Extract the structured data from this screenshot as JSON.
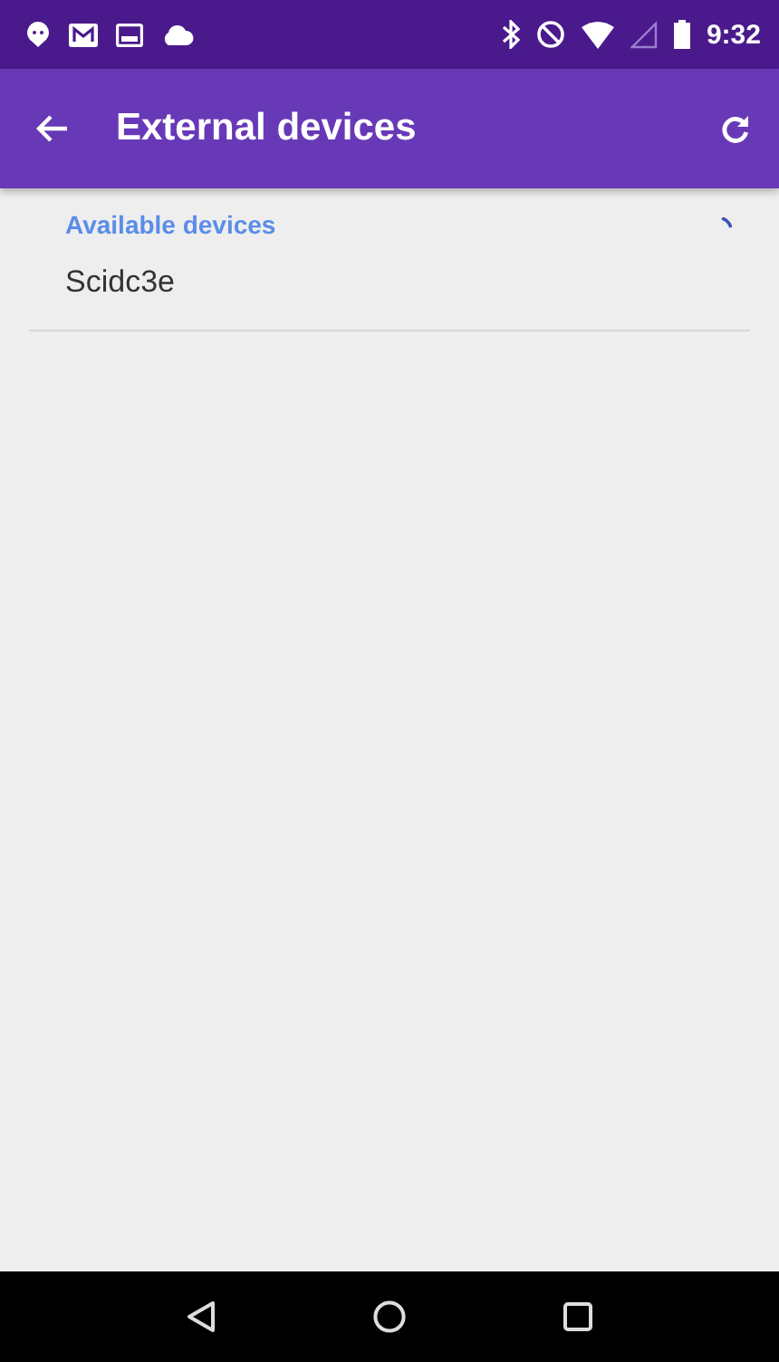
{
  "status_bar": {
    "time": "9:32"
  },
  "app_bar": {
    "title": "External devices"
  },
  "section": {
    "header": "Available devices"
  },
  "devices": [
    {
      "name": "Scidc3e"
    }
  ]
}
